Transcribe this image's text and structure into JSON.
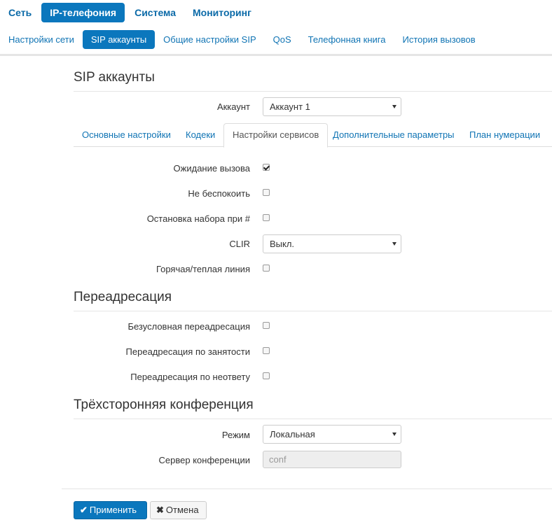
{
  "topnav": [
    {
      "label": "Сеть"
    },
    {
      "label": "IP-телефония"
    },
    {
      "label": "Система"
    },
    {
      "label": "Мониторинг"
    }
  ],
  "subnav": [
    {
      "label": "Настройки сети"
    },
    {
      "label": "SIP аккаунты"
    },
    {
      "label": "Общие настройки SIP"
    },
    {
      "label": "QoS"
    },
    {
      "label": "Телефонная книга"
    },
    {
      "label": "История вызовов"
    }
  ],
  "page": {
    "title": "SIP аккаунты",
    "account_label": "Аккаунт",
    "account_value": "Аккаунт 1"
  },
  "tabs": [
    {
      "label": "Основные настройки"
    },
    {
      "label": "Кодеки"
    },
    {
      "label": "Настройки сервисов"
    },
    {
      "label": "Дополнительные параметры"
    },
    {
      "label": "План нумерации"
    }
  ],
  "services": {
    "call_waiting_label": "Ожидание вызова",
    "call_waiting_checked": true,
    "dnd_label": "Не беспокоить",
    "dnd_checked": false,
    "stop_dial_label": "Остановка набора при #",
    "stop_dial_checked": false,
    "clir_label": "CLIR",
    "clir_value": "Выкл.",
    "hotline_label": "Горячая/теплая линия",
    "hotline_checked": false
  },
  "forwarding": {
    "title": "Переадресация",
    "unconditional_label": "Безусловная переадресация",
    "busy_label": "Переадресация по занятости",
    "no_answer_label": "Переадресация по неответу"
  },
  "conference": {
    "title": "Трёхсторонняя конференция",
    "mode_label": "Режим",
    "mode_value": "Локальная",
    "server_label": "Сервер конференции",
    "server_placeholder": "conf"
  },
  "buttons": {
    "apply_icon": "check-icon",
    "apply_label": "Применить",
    "cancel_icon": "close-icon",
    "cancel_label": "Отмена"
  },
  "colors": {
    "accent": "#0b77bd",
    "link": "#1074b4"
  }
}
